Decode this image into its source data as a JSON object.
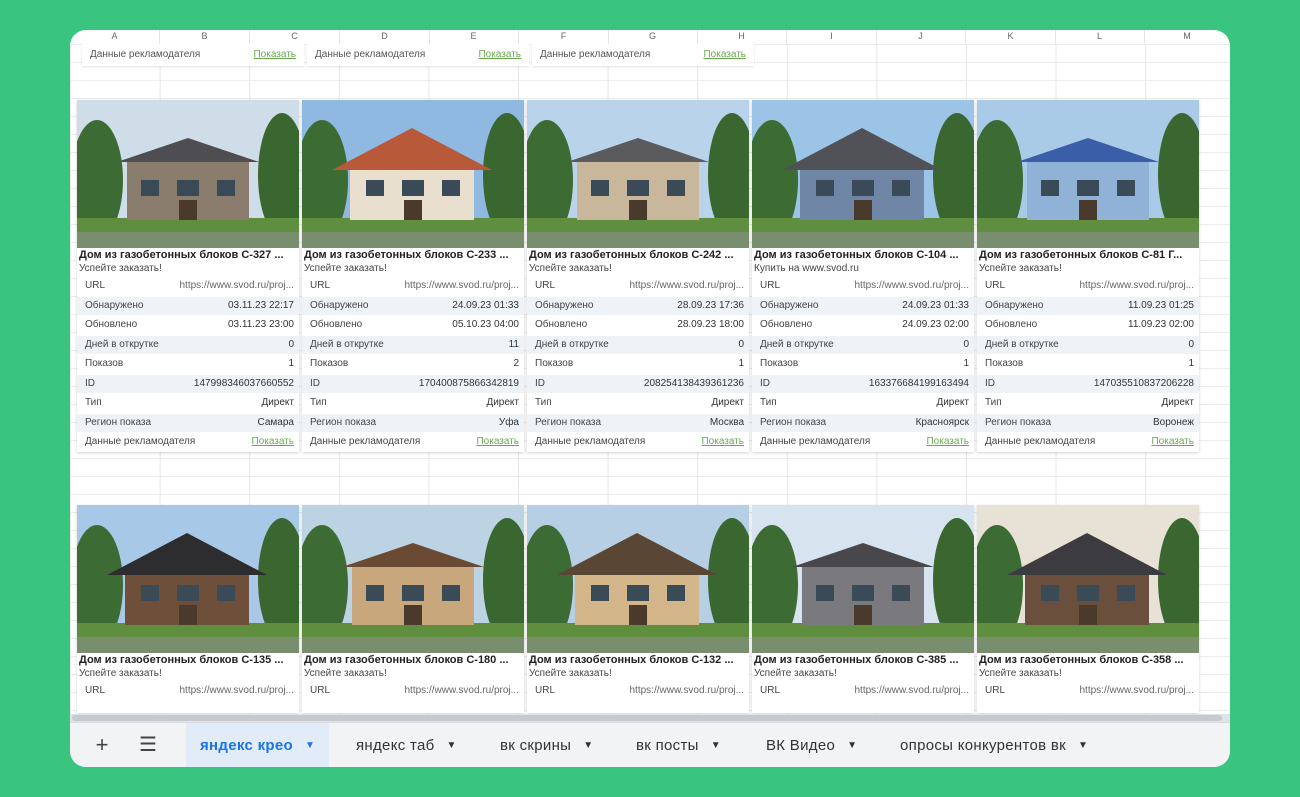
{
  "columns": [
    "A",
    "B",
    "C",
    "D",
    "E",
    "F",
    "G",
    "H",
    "I",
    "J",
    "K",
    "L",
    "M"
  ],
  "top_row": [
    {
      "label": "Данные рекламодателя",
      "link": "Показать"
    },
    {
      "label": "Данные рекламодателя",
      "link": "Показать"
    },
    {
      "label": "Данные рекламодателя",
      "link": "Показать"
    }
  ],
  "field_labels": {
    "url": "URL",
    "found": "Обнаружено",
    "updated": "Обновлено",
    "days": "Дней в открутке",
    "shows": "Показов",
    "id": "ID",
    "type": "Тип",
    "region": "Регион показа",
    "advertiser": "Данные рекламодателя"
  },
  "row1": [
    {
      "title": "Дом из газобетонных блоков С-327 ...",
      "subtitle": "Успейте заказать!",
      "url": "https://www.svod.ru/proj...",
      "found": "03.11.23 22:17",
      "updated": "03.11.23 23:00",
      "days": "0",
      "shows": "1",
      "id": "147998346037660552",
      "type": "Директ",
      "region": "Самара",
      "advertiser": "Показать"
    },
    {
      "title": "Дом из газобетонных блоков С-233 ...",
      "subtitle": "Успейте заказать!",
      "url": "https://www.svod.ru/proj...",
      "found": "24.09.23 01:33",
      "updated": "05.10.23 04:00",
      "days": "11",
      "shows": "2",
      "id": "170400875866342819",
      "type": "Директ",
      "region": "Уфа",
      "advertiser": "Показать"
    },
    {
      "title": "Дом из газобетонных блоков С-242 ...",
      "subtitle": "Успейте заказать!",
      "url": "https://www.svod.ru/proj...",
      "found": "28.09.23 17:36",
      "updated": "28.09.23 18:00",
      "days": "0",
      "shows": "1",
      "id": "208254138439361236",
      "type": "Директ",
      "region": "Москва",
      "advertiser": "Показать"
    },
    {
      "title": "Дом из газобетонных блоков С-104 ...",
      "subtitle": "Купить на www.svod.ru",
      "url": "https://www.svod.ru/proj...",
      "found": "24.09.23 01:33",
      "updated": "24.09.23 02:00",
      "days": "0",
      "shows": "1",
      "id": "163376684199163494",
      "type": "Директ",
      "region": "Красноярск",
      "advertiser": "Показать"
    },
    {
      "title": "Дом из газобетонных блоков С-81 Г...",
      "subtitle": "Успейте заказать!",
      "url": "https://www.svod.ru/proj...",
      "found": "11.09.23 01:25",
      "updated": "11.09.23 02:00",
      "days": "0",
      "shows": "1",
      "id": "147035510837206228",
      "type": "Директ",
      "region": "Воронеж",
      "advertiser": "Показать"
    }
  ],
  "row2": [
    {
      "title": "Дом из газобетонных блоков С-135 ...",
      "subtitle": "Успейте заказать!",
      "url": "https://www.svod.ru/proj..."
    },
    {
      "title": "Дом из газобетонных блоков С-180 ...",
      "subtitle": "Успейте заказать!",
      "url": "https://www.svod.ru/proj..."
    },
    {
      "title": "Дом из газобетонных блоков С-132 ...",
      "subtitle": "Успейте заказать!",
      "url": "https://www.svod.ru/proj..."
    },
    {
      "title": "Дом из газобетонных блоков С-385 ...",
      "subtitle": "Успейте заказать!",
      "url": "https://www.svod.ru/proj..."
    },
    {
      "title": "Дом из газобетонных блоков С-358 ...",
      "subtitle": "Успейте заказать!",
      "url": "https://www.svod.ru/proj..."
    }
  ],
  "tabs": [
    {
      "label": "яндекс крео",
      "active": true
    },
    {
      "label": "яндекс таб"
    },
    {
      "label": "вк скрины"
    },
    {
      "label": "вк посты"
    },
    {
      "label": "ВК Видео"
    },
    {
      "label": "опросы конкурентов вк"
    }
  ],
  "icons": {
    "add": "plus-icon",
    "menu": "hamburger-icon",
    "tab_menu": "caret-down-icon"
  },
  "colors": {
    "background": "#39c57f",
    "active_tab": "#1a73e8",
    "link": "#6aa84f",
    "row_alt": "#eef3f8"
  }
}
